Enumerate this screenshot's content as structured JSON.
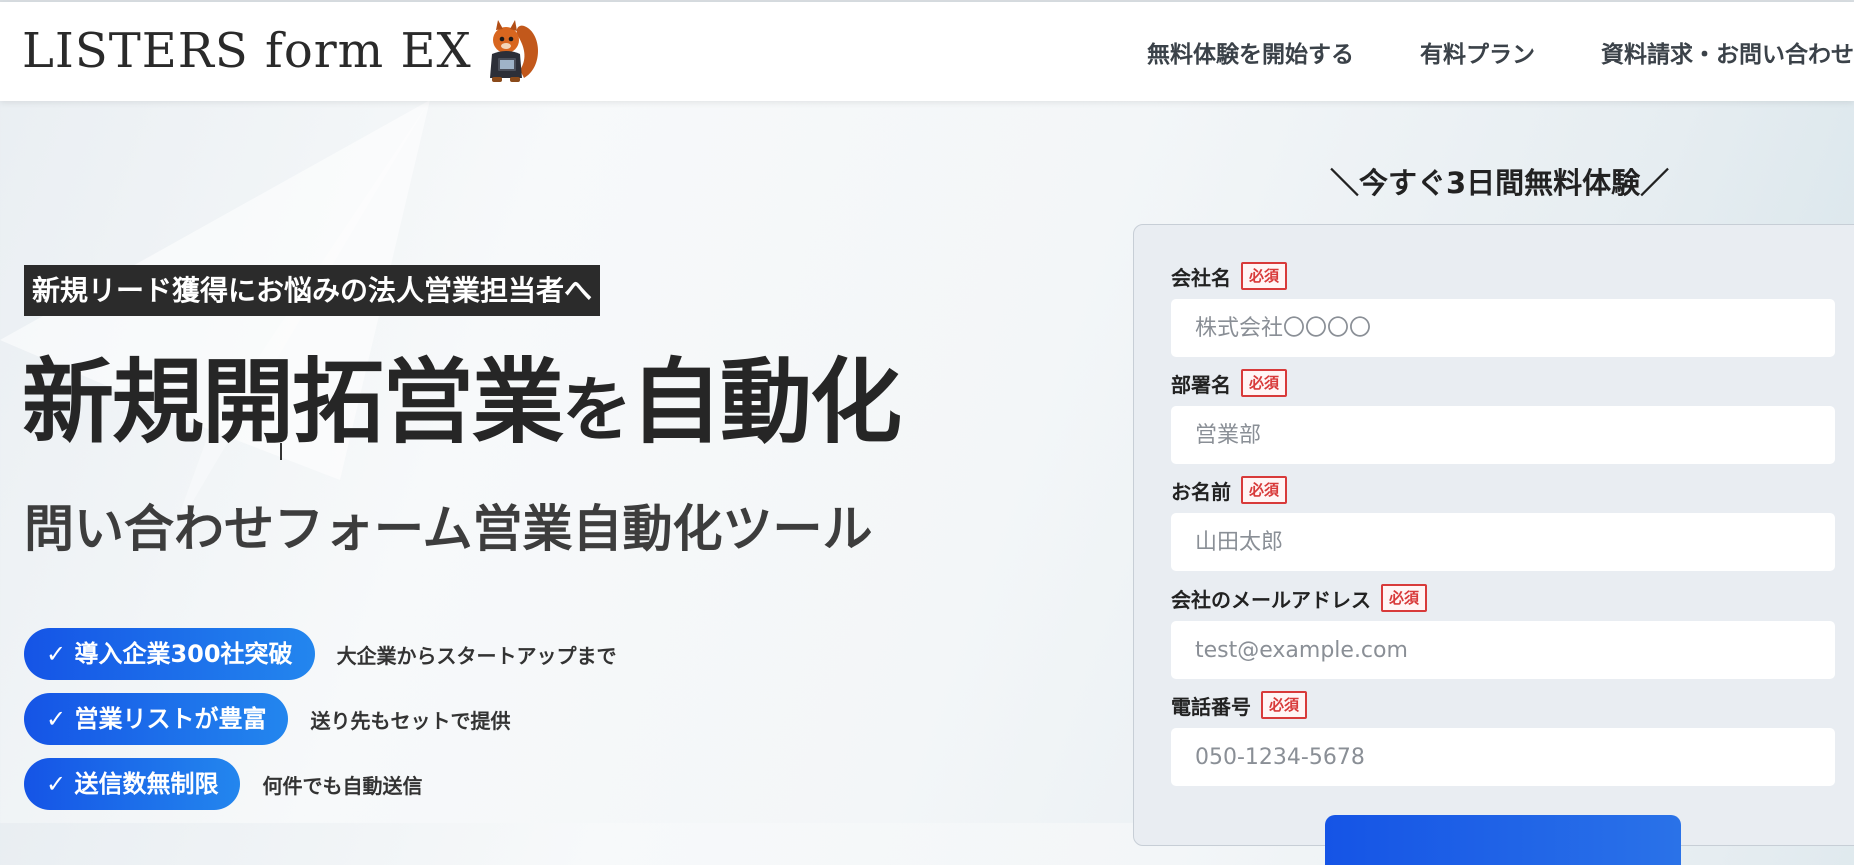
{
  "header": {
    "logo_text": "LISTERS form EX",
    "logo_icon": "squirrel-mascot-icon",
    "nav": [
      {
        "label": "無料体験を開始する"
      },
      {
        "label": "有料プラン"
      },
      {
        "label": "資料請求・お問い合わせ"
      }
    ]
  },
  "hero": {
    "tagline": "新規リード獲得にお悩みの法人営業担当者へ",
    "headline_a": "新規開拓営業",
    "headline_b": "を",
    "headline_c": "自動化",
    "subheadline": "問い合わせフォーム営業自動化ツール",
    "features": [
      {
        "pill": "✓ 導入企業300社突破",
        "note": "大企業からスタートアップまで"
      },
      {
        "pill": "✓ 営業リストが豊富",
        "note": "送り先もセットで提供"
      },
      {
        "pill": "✓ 送信数無制限",
        "note": "何件でも自動送信"
      }
    ]
  },
  "form": {
    "title": "＼今すぐ3日間無料体験／",
    "required_badge": "必須",
    "fields": [
      {
        "label": "会社名",
        "placeholder": "株式会社〇〇〇〇"
      },
      {
        "label": "部署名",
        "placeholder": "営業部"
      },
      {
        "label": "お名前",
        "placeholder": "山田太郎"
      },
      {
        "label": "会社のメールアドレス",
        "placeholder": "test@example.com"
      },
      {
        "label": "電話番号",
        "placeholder": "050-1234-5678"
      }
    ]
  },
  "colors": {
    "accent_blue": "#1554e6",
    "required_red": "#d83a3a",
    "tagline_bg": "#2b2b2b"
  }
}
